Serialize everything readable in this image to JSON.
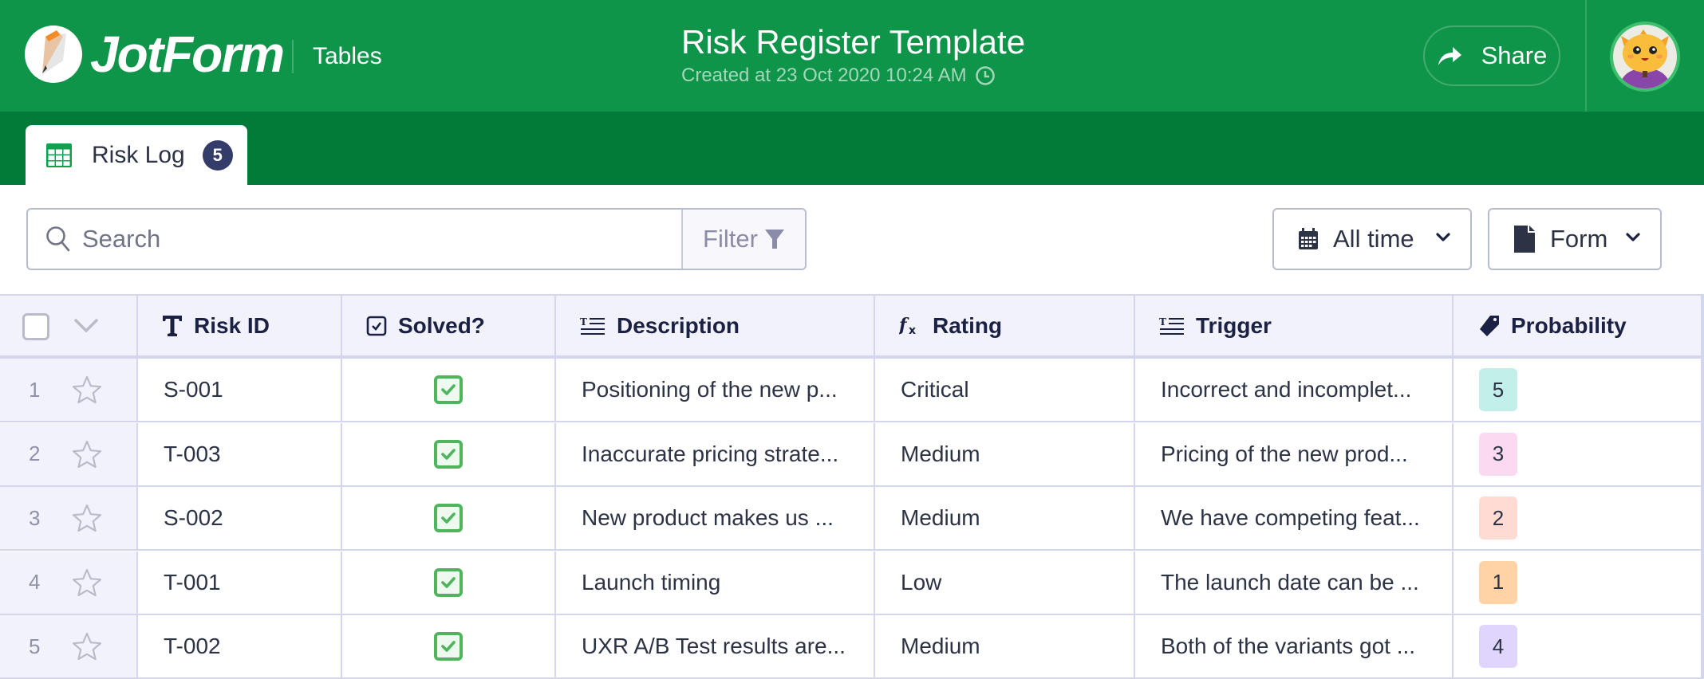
{
  "header": {
    "brand": "JotForm",
    "app_name": "Tables",
    "title": "Risk Register Template",
    "created": "Created at 23 Oct 2020 10:24 AM",
    "share_label": "Share",
    "colors": {
      "primary_green": "#0f954a",
      "dark_green": "#027a38"
    }
  },
  "tabs": [
    {
      "label": "Risk Log",
      "count": "5",
      "icon": "grid-table-icon",
      "active": true
    }
  ],
  "toolbar": {
    "search_placeholder": "Search",
    "search_value": "",
    "filter_label": "Filter",
    "date_range": "All time",
    "view": "Form"
  },
  "table": {
    "columns": [
      {
        "label": "Risk ID",
        "icon": "text-type-icon"
      },
      {
        "label": "Solved?",
        "icon": "checkbox-type-icon"
      },
      {
        "label": "Description",
        "icon": "long-text-type-icon"
      },
      {
        "label": "Rating",
        "icon": "formula-type-icon"
      },
      {
        "label": "Trigger",
        "icon": "long-text-type-icon"
      },
      {
        "label": "Probability",
        "icon": "tag-type-icon"
      }
    ],
    "rows": [
      {
        "num": "1",
        "risk_id": "S-001",
        "solved": true,
        "description": "Positioning of the new p...",
        "rating": "Critical",
        "trigger": "Incorrect and incomplet...",
        "probability": "5",
        "prob_color": "#c3efea"
      },
      {
        "num": "2",
        "risk_id": "T-003",
        "solved": true,
        "description": "Inaccurate pricing strate...",
        "rating": "Medium",
        "trigger": "Pricing of the new prod...",
        "probability": "3",
        "prob_color": "#fbdaf1"
      },
      {
        "num": "3",
        "risk_id": "S-002",
        "solved": true,
        "description": "New product makes us ...",
        "rating": "Medium",
        "trigger": "We have competing feat...",
        "probability": "2",
        "prob_color": "#ffdbd3"
      },
      {
        "num": "4",
        "risk_id": "T-001",
        "solved": true,
        "description": "Launch timing",
        "rating": "Low",
        "trigger": "The launch date can be ...",
        "probability": "1",
        "prob_color": "#ffd3a5"
      },
      {
        "num": "5",
        "risk_id": "T-002",
        "solved": true,
        "description": "UXR A/B Test results are...",
        "rating": "Medium",
        "trigger": "Both of the variants got ...",
        "probability": "4",
        "prob_color": "#e0d5fc"
      }
    ]
  }
}
